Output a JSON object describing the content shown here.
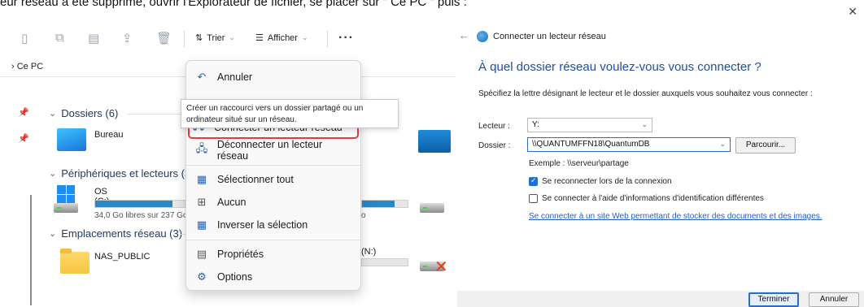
{
  "top_text": "eur réseau a été supprimé, ouvrir l'Explorateur de fichier, se placer sur \" Ce PC \" puis :",
  "explorer": {
    "toolbar": {
      "sort_label": "Trier",
      "view_label": "Afficher",
      "more_label": "···"
    },
    "address": "Ce PC",
    "sections": {
      "folders": "Dossiers (6)",
      "devices": "Périphériques et lecteurs (3",
      "network": "Emplacements réseau (3)"
    },
    "items": {
      "bureau": "Bureau",
      "os_drive": "OS (C:)",
      "os_free": "34,0 Go libres sur 237 Go",
      "nas": "NAS_PUBLIC",
      "n_drive_partial": "(N:)",
      "partial_o": "o"
    },
    "os_drive_usage": 0.86,
    "second_drive_usage": 0.72
  },
  "context_menu": {
    "items": [
      {
        "label": "Annuler",
        "icon": "undo-icon"
      },
      {
        "label": "Connecter un lecteur réseau",
        "icon": "map-drive-icon"
      },
      {
        "label": "Déconnecter un lecteur réseau",
        "icon": "disconnect-drive-icon"
      },
      {
        "label": "Sélectionner tout",
        "icon": "select-all-icon"
      },
      {
        "label": "Aucun",
        "icon": "select-none-icon"
      },
      {
        "label": "Inverser la sélection",
        "icon": "invert-selection-icon"
      },
      {
        "label": "Propriétés",
        "icon": "properties-icon"
      },
      {
        "label": "Options",
        "icon": "options-icon"
      }
    ],
    "tooltip": "Créer un raccourci vers un dossier partagé ou un ordinateur situé sur un réseau."
  },
  "dialog": {
    "title": "Connecter un lecteur réseau",
    "heading": "À quel dossier réseau voulez-vous vous connecter ?",
    "description": "Spécifiez la lettre désignant le lecteur et le dossier auxquels vous souhaitez vous connecter :",
    "drive_label": "Lecteur :",
    "drive_value": "Y:",
    "folder_label": "Dossier :",
    "folder_value": "\\\\QUANTUMFFN18\\QuantumDB",
    "browse_label": "Parcourir...",
    "example": "Exemple : \\\\serveur\\partage",
    "reconnect_label": "Se reconnecter lors de la connexion",
    "reconnect_checked": true,
    "other_credentials_label": "Se connecter à l'aide d'informations d'identification différentes",
    "other_credentials_checked": false,
    "website_link": "Se connecter à un site Web permettant de stocker des documents et des images.",
    "finish_label": "Terminer",
    "cancel_label": "Annuler"
  }
}
